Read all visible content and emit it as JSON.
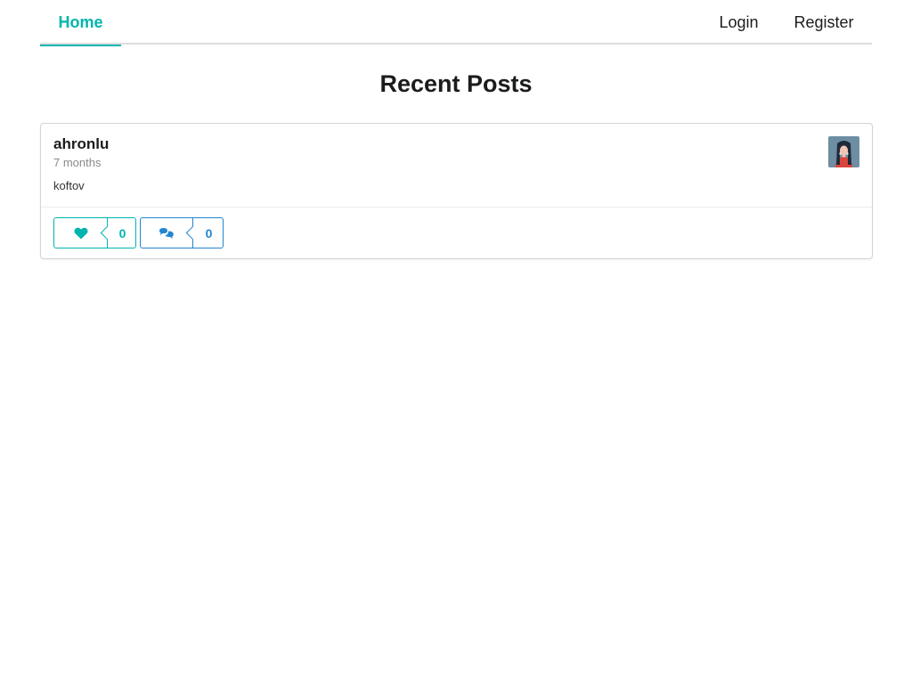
{
  "nav": {
    "home": "Home",
    "login": "Login",
    "register": "Register"
  },
  "page_title": "Recent Posts",
  "post": {
    "author": "ahronlu",
    "time": "7 months",
    "body": "koftov",
    "likes": "0",
    "comments": "0"
  },
  "colors": {
    "accent_teal": "#00b5ad",
    "accent_blue": "#2185d0"
  },
  "icons": {
    "like": "heart-icon",
    "comment": "comments-icon"
  }
}
